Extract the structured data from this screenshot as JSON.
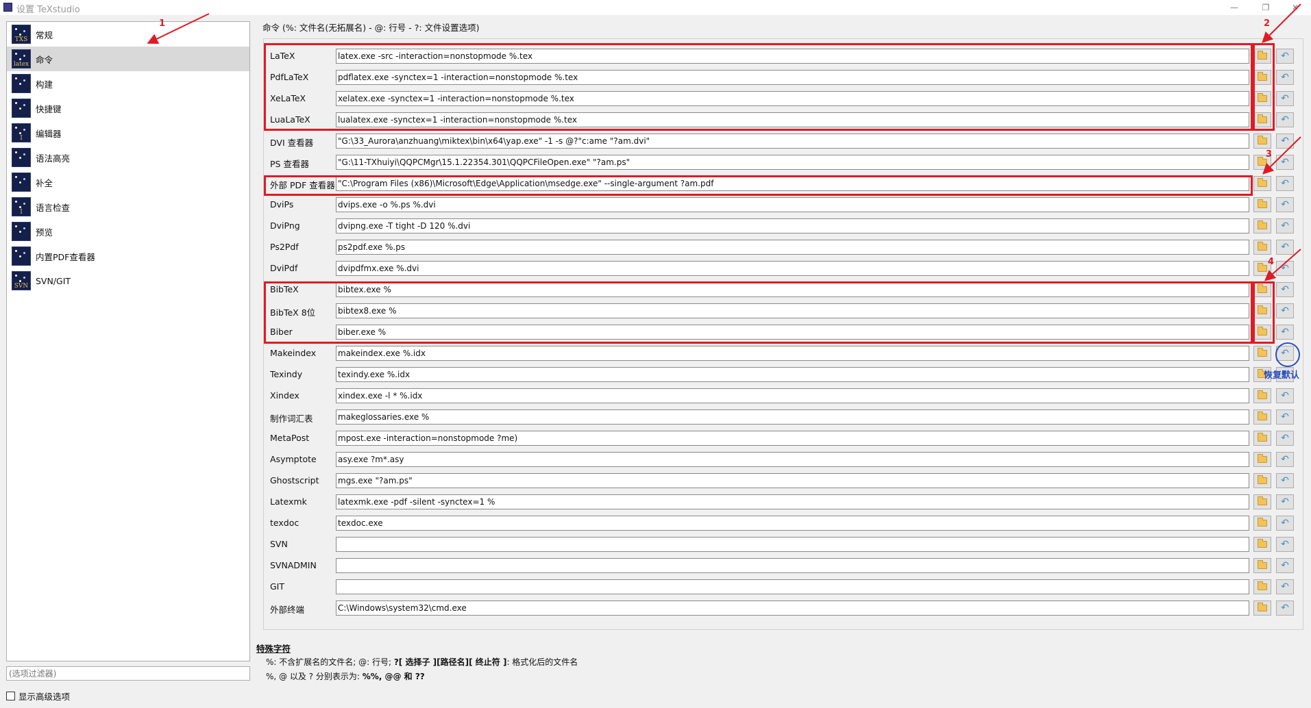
{
  "window": {
    "title": "设置 TeXstudio",
    "controls": [
      "—",
      "❐",
      "✕"
    ]
  },
  "sidebar": {
    "items": [
      {
        "label": "常规",
        "icon_text": "TXS",
        "icon": "txs-general-icon"
      },
      {
        "label": "命令",
        "icon_text": "latex",
        "icon": "latex-command-icon"
      },
      {
        "label": "构建",
        "icon_text": "",
        "icon": "build-icon"
      },
      {
        "label": "快捷键",
        "icon_text": "",
        "icon": "shortcut-icon"
      },
      {
        "label": "编辑器",
        "icon_text": "I",
        "icon": "editor-icon"
      },
      {
        "label": "语法高亮",
        "icon_text": "",
        "icon": "syntax-highlight-icon"
      },
      {
        "label": "补全",
        "icon_text": "",
        "icon": "completion-icon"
      },
      {
        "label": "语言检查",
        "icon_text": "I",
        "icon": "language-check-icon"
      },
      {
        "label": "预览",
        "icon_text": "",
        "icon": "preview-icon"
      },
      {
        "label": "内置PDF查看器",
        "icon_text": "",
        "icon": "pdf-viewer-icon"
      },
      {
        "label": "SVN/GIT",
        "icon_text": "SVN",
        "icon": "svn-git-icon"
      }
    ],
    "active_index": 1,
    "filter_placeholder": "(选项过滤器)",
    "advanced_label": "显示高级选项"
  },
  "main": {
    "header": "命令 (%: 文件名(无拓展名) - @: 行号 - ?: 文件设置选项)",
    "commands": [
      {
        "label": "LaTeX",
        "value": "latex.exe -src -interaction=nonstopmode %.tex"
      },
      {
        "label": "PdfLaTeX",
        "value": "pdflatex.exe -synctex=1 -interaction=nonstopmode %.tex"
      },
      {
        "label": "XeLaTeX",
        "value": "xelatex.exe -synctex=1 -interaction=nonstopmode %.tex"
      },
      {
        "label": "LuaLaTeX",
        "value": "lualatex.exe -synctex=1 -interaction=nonstopmode %.tex"
      },
      {
        "label": "DVI 查看器",
        "value": "\"G:\\33_Aurora\\anzhuang\\miktex\\bin\\x64\\yap.exe\" -1 -s @?\"c:ame \"?am.dvi\""
      },
      {
        "label": "PS 查看器",
        "value": "\"G:\\11-TXhuiyi\\QQPCMgr\\15.1.22354.301\\QQPCFileOpen.exe\" \"?am.ps\""
      },
      {
        "label": "外部 PDF 查看器",
        "value": "\"C:\\Program Files (x86)\\Microsoft\\Edge\\Application\\msedge.exe\" --single-argument ?am.pdf"
      },
      {
        "label": "DviPs",
        "value": "dvips.exe -o %.ps %.dvi"
      },
      {
        "label": "DviPng",
        "value": "dvipng.exe -T tight -D 120 %.dvi"
      },
      {
        "label": "Ps2Pdf",
        "value": "ps2pdf.exe %.ps"
      },
      {
        "label": "DviPdf",
        "value": "dvipdfmx.exe %.dvi"
      },
      {
        "label": "BibTeX",
        "value": "bibtex.exe %"
      },
      {
        "label": "BibTeX 8位",
        "value": "bibtex8.exe %"
      },
      {
        "label": "Biber",
        "value": "biber.exe %"
      },
      {
        "label": "Makeindex",
        "value": "makeindex.exe %.idx"
      },
      {
        "label": "Texindy",
        "value": "texindy.exe %.idx"
      },
      {
        "label": "Xindex",
        "value": "xindex.exe -l * %.idx"
      },
      {
        "label": "制作词汇表",
        "value": "makeglossaries.exe %"
      },
      {
        "label": "MetaPost",
        "value": "mpost.exe -interaction=nonstopmode ?me)"
      },
      {
        "label": "Asymptote",
        "value": "asy.exe ?m*.asy"
      },
      {
        "label": "Ghostscript",
        "value": "mgs.exe \"?am.ps\""
      },
      {
        "label": "Latexmk",
        "value": "latexmk.exe -pdf -silent -synctex=1 %"
      },
      {
        "label": "texdoc",
        "value": "texdoc.exe"
      },
      {
        "label": "SVN",
        "value": ""
      },
      {
        "label": "SVNADMIN",
        "value": ""
      },
      {
        "label": "GIT",
        "value": ""
      },
      {
        "label": "外部终端",
        "value": "C:\\Windows\\system32\\cmd.exe"
      }
    ],
    "special": {
      "title": "特殊字符",
      "line1_a": "%: 不含扩展名的文件名;  @: 行号;  ",
      "line1_b": "?[ 选择子 ][路径名][ 终止符 ]",
      "line1_c": ": 格式化后的文件名",
      "line2_a": "%, @ 以及 ? 分别表示为: ",
      "line2_b": "%%, @@ 和 ??"
    }
  },
  "annotations": {
    "numbers": [
      "1",
      "2",
      "3",
      "4"
    ],
    "restore_default": "恢复默认",
    "color": "#e01b24"
  }
}
